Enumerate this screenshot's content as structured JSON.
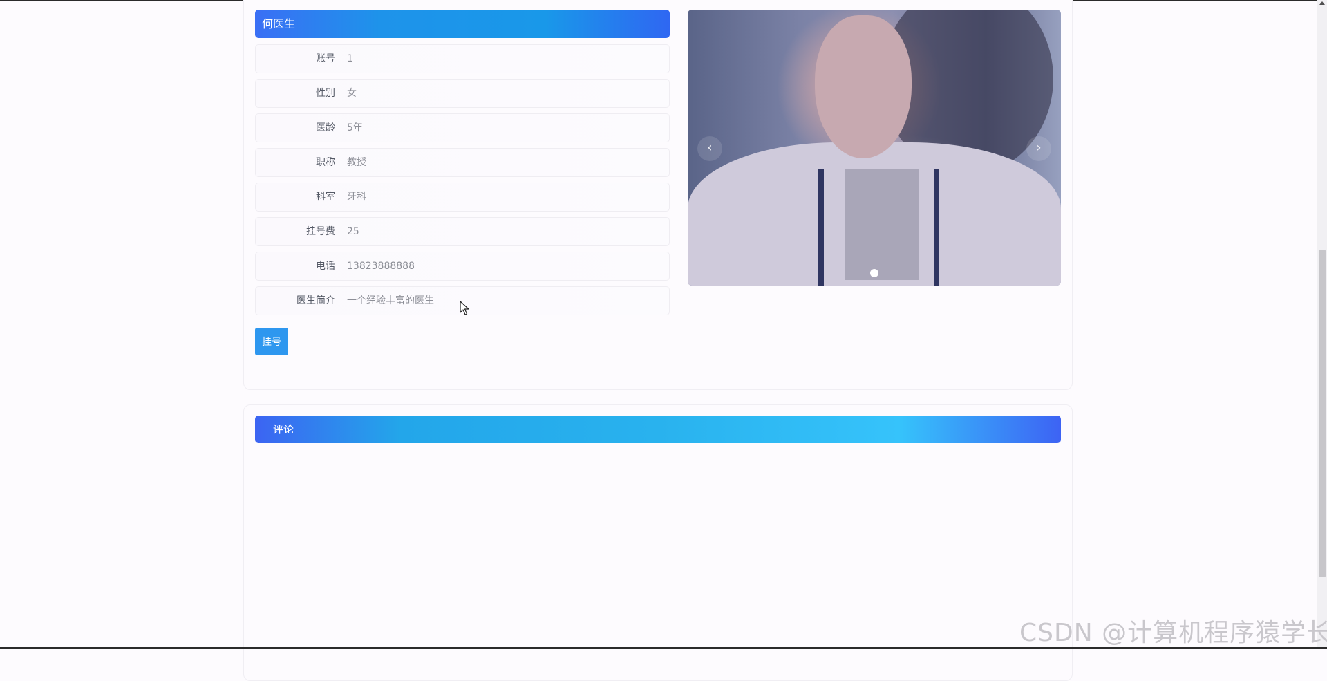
{
  "doctor": {
    "name": "何医生",
    "register_button": "挂号",
    "fields": [
      {
        "label": "账号",
        "value": "1"
      },
      {
        "label": "性别",
        "value": "女"
      },
      {
        "label": "医龄",
        "value": "5年"
      },
      {
        "label": "职称",
        "value": "教授"
      },
      {
        "label": "科室",
        "value": "牙科"
      },
      {
        "label": "挂号费",
        "value": "25"
      },
      {
        "label": "电话",
        "value": "13823888888"
      },
      {
        "label": "医生简介",
        "value": "一个经验丰富的医生"
      }
    ]
  },
  "carousel": {
    "prev_icon": "‹",
    "next_icon": "›",
    "slide_count": 1,
    "active_index": 0
  },
  "comments": {
    "title": "评论"
  },
  "watermark": "CSDN @计算机程序猿学长",
  "colors": {
    "header_gradient_start": "#3a6ff5",
    "header_gradient_mid": "#1e93ea",
    "button_blue": "#2e97ef",
    "comment_bar_light": "#36c3fb"
  }
}
